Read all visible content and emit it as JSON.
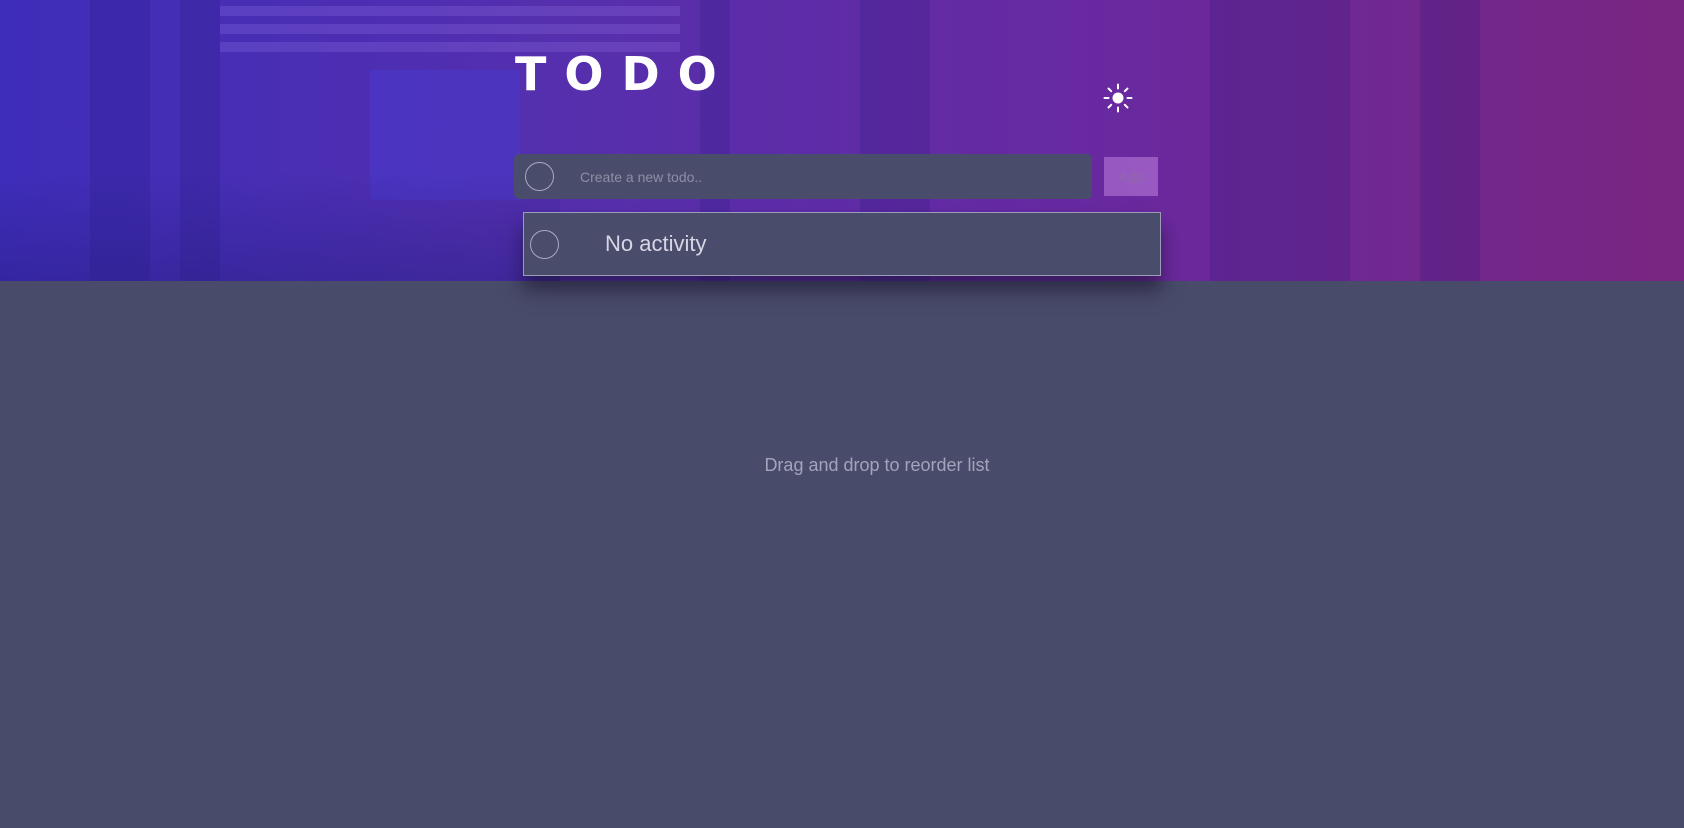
{
  "header": {
    "title": "TODO",
    "theme_toggle_icon": "sun-icon"
  },
  "new_todo": {
    "placeholder": "Create a new todo..",
    "value": "",
    "add_label": "Add"
  },
  "todos": [
    {
      "text": "No activity",
      "completed": false
    }
  ],
  "footer": {
    "hint": "Drag and drop to reorder list"
  },
  "colors": {
    "background": "#484b6a",
    "panel": "#4a4c6b",
    "title": "#ffffff",
    "hint_text": "#a3a4bb",
    "add_button": "#be82dc"
  }
}
